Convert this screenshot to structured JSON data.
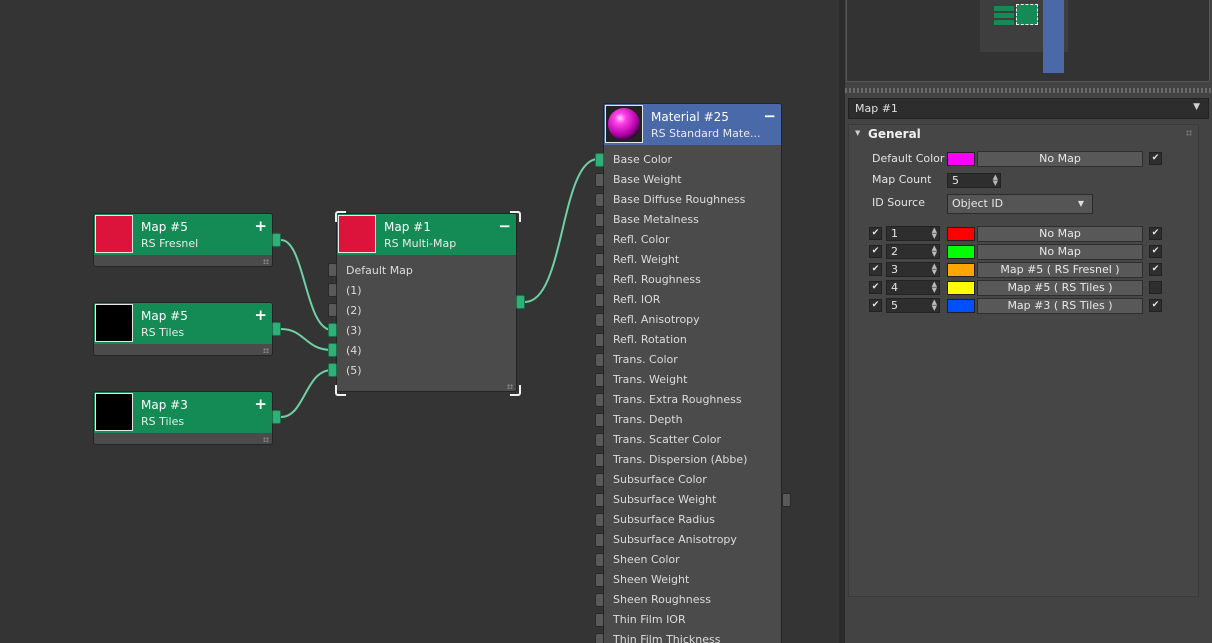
{
  "nodes": {
    "fresnel": {
      "title": "Map #5",
      "subtitle": "RS Fresnel",
      "button": "+",
      "thumb_color": "#dc143c"
    },
    "tiles5": {
      "title": "Map #5",
      "subtitle": "RS Tiles",
      "button": "+",
      "thumb_color": "#000000"
    },
    "tiles3": {
      "title": "Map #3",
      "subtitle": "RS Tiles",
      "button": "+",
      "thumb_color": "#000000"
    },
    "multimap": {
      "title": "Map #1",
      "subtitle": "RS Multi-Map",
      "button": "−",
      "thumb_color": "#dc143c",
      "slots": [
        "Default Map",
        "(1)",
        "(2)",
        "(3)",
        "(4)",
        "(5)"
      ]
    },
    "material": {
      "title": "Material #25",
      "subtitle": "RS Standard Mate...",
      "button": "−",
      "slots": [
        "Base Color",
        "Base Weight",
        "Base Diffuse Roughness",
        "Base Metalness",
        "Refl. Color",
        "Refl. Weight",
        "Refl. Roughness",
        "Refl. IOR",
        "Refl. Anisotropy",
        "Refl. Rotation",
        "Trans. Color",
        "Trans. Weight",
        "Trans. Extra Roughness",
        "Trans. Depth",
        "Trans. Scatter Color",
        "Trans. Dispersion (Abbe)",
        "Subsurface Color",
        "Subsurface Weight",
        "Subsurface Radius",
        "Subsurface Anisotropy",
        "Sheen Color",
        "Sheen Weight",
        "Sheen Roughness",
        "Thin Film IOR",
        "Thin Film Thickness"
      ]
    }
  },
  "panel": {
    "selector": "Map #1",
    "section": "General",
    "default_color_label": "Default Color",
    "default_color": "#ff00ff",
    "default_map": "No Map",
    "map_count_label": "Map Count",
    "map_count": "5",
    "id_source_label": "ID Source",
    "id_source": "Object ID",
    "rows": [
      {
        "id": "1",
        "color": "#ff0000",
        "map": "No Map",
        "enabled": true,
        "use": true
      },
      {
        "id": "2",
        "color": "#00ff00",
        "map": "No Map",
        "enabled": true,
        "use": true
      },
      {
        "id": "3",
        "color": "#ffa500",
        "map": "Map #5  ( RS Fresnel )",
        "enabled": true,
        "use": true
      },
      {
        "id": "4",
        "color": "#ffff00",
        "map": "Map #5  ( RS Tiles )",
        "enabled": true,
        "use": false
      },
      {
        "id": "5",
        "color": "#0050ff",
        "map": "Map #3  ( RS Tiles )",
        "enabled": true,
        "use": true
      }
    ]
  },
  "icons": {
    "check": "✔",
    "collapse": "▼",
    "spin_up": "▲",
    "spin_down": "▼"
  }
}
